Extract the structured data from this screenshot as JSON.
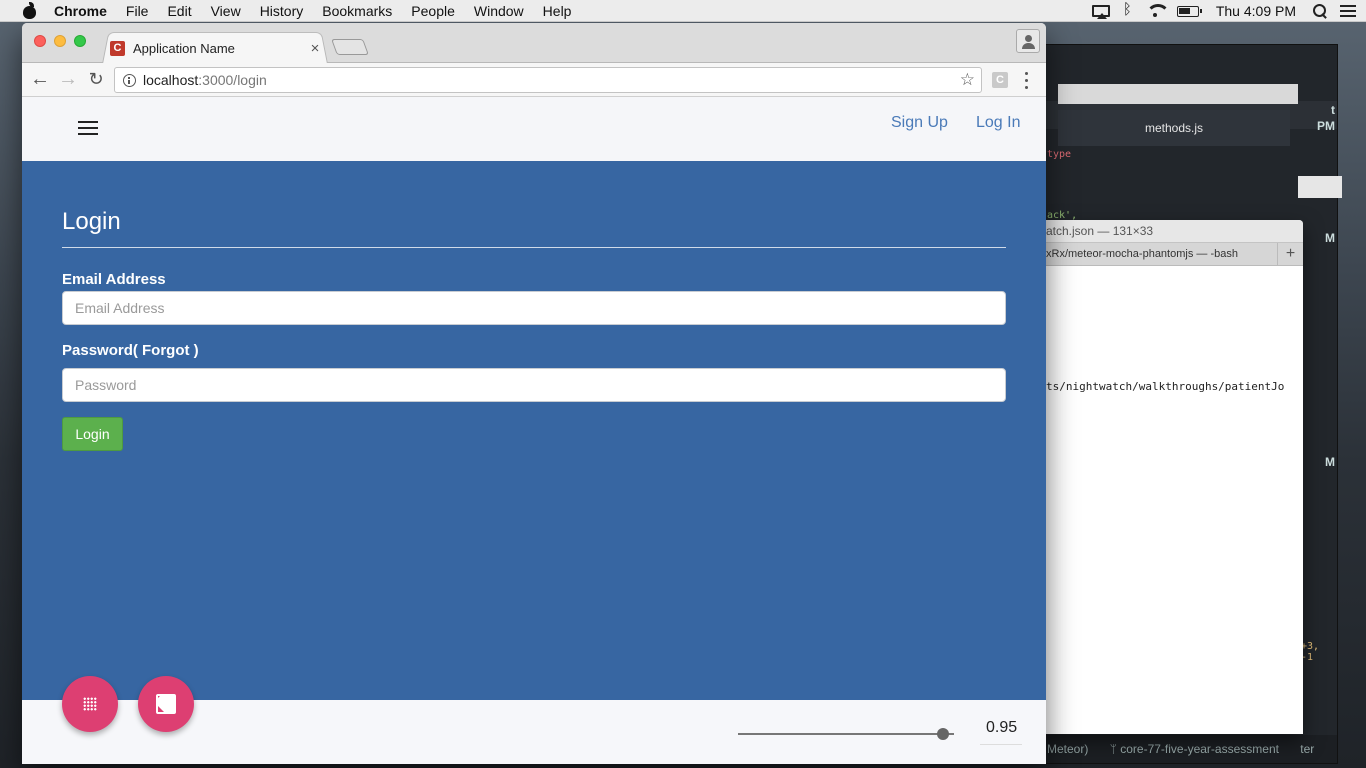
{
  "menubar": {
    "app_name": "Chrome",
    "items": [
      "File",
      "Edit",
      "View",
      "History",
      "Bookmarks",
      "People",
      "Window",
      "Help"
    ],
    "clock": "Thu 4:09 PM"
  },
  "background_windows": {
    "editor_tab": "methods.js",
    "code_line1": "type",
    "code_line2": "ack',",
    "code_line3": "+3, -1",
    "edge_text1": "t",
    "edge_text2": "PM",
    "edge_text3": "M",
    "edge_text4": "M",
    "status_text1": "Meteor)",
    "status_text2": "core-77-five-year-assessment",
    "status_text3": "ter",
    "terminal_title": "atch.json — 131×33",
    "terminal_tab": "xRx/meteor-mocha-phantomjs — -bash",
    "terminal_plus": "+",
    "terminal_line": "ts/nightwatch/walkthroughs/patientJo"
  },
  "browser": {
    "tab_title": "Application Name",
    "tab_close": "×",
    "favicon_letter": "C",
    "url_host": "localhost",
    "url_path": ":3000/login",
    "extension_letter": "C",
    "nav": {
      "back": "←",
      "forward": "→",
      "reload": "↻",
      "star": "☆"
    }
  },
  "header": {
    "signup_label": "Sign Up",
    "login_label": "Log In"
  },
  "form": {
    "title": "Login",
    "email_label": "Email Address",
    "email_placeholder": "Email Address",
    "email_value": "",
    "password_label": "Password( Forgot )",
    "password_placeholder": "Password",
    "password_value": "",
    "submit_label": "Login"
  },
  "footer": {
    "opacity_value": "0.95",
    "opacity_fraction": 0.95
  },
  "colors": {
    "panel_bg": "#3766a2",
    "accent_pink": "#dd3f72",
    "login_green": "#5cb04d",
    "link_blue": "#4a7ab8"
  },
  "icons": [
    "apple-icon",
    "airplay-icon",
    "bluetooth-icon",
    "wifi-icon",
    "battery-icon",
    "spotlight-icon",
    "notification-list-icon",
    "hamburger-icon",
    "grid-icon",
    "image-add-icon"
  ]
}
